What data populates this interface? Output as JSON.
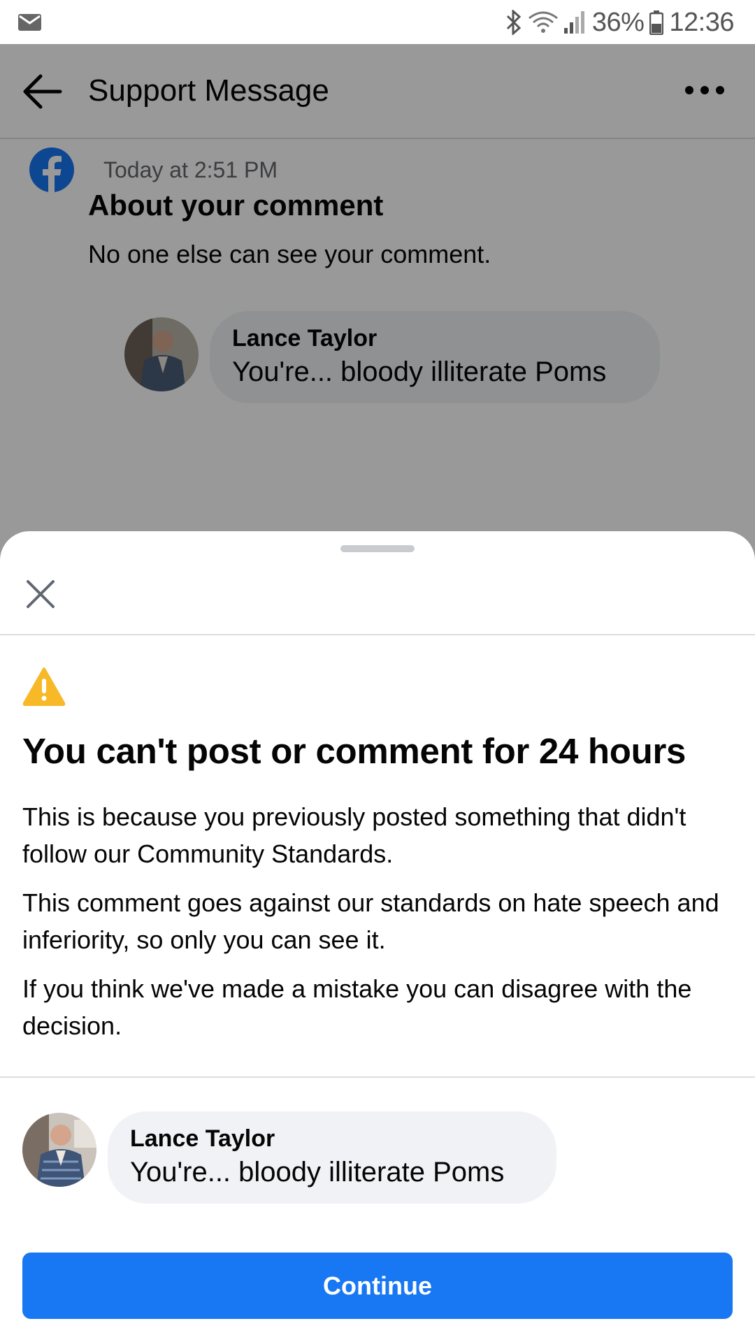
{
  "status_bar": {
    "battery": "36%",
    "time": "12:36"
  },
  "header": {
    "title": "Support Message"
  },
  "message": {
    "time": "Today at 2:51 PM",
    "heading": "About your comment",
    "body": "No one else can see your comment."
  },
  "comment": {
    "author": "Lance Taylor",
    "text": "You're...  bloody illiterate Poms"
  },
  "sheet": {
    "title": "You can't post or comment for 24 hours",
    "paragraphs": [
      "This is because you previously posted something that didn't follow our Community Standards.",
      "This comment goes against our standards on hate speech and inferiority, so only you can see it.",
      "If you think we've made a mistake you can disagree with the decision."
    ],
    "continue_label": "Continue"
  },
  "colors": {
    "accent": "#1877f2",
    "warning": "#f7b928",
    "bubble": "#f0f2f5",
    "secondary_text": "#65676b"
  },
  "icons": [
    "mail-icon",
    "bluetooth-icon",
    "wifi-icon",
    "signal-icon",
    "battery-icon",
    "back-arrow-icon",
    "more-icon",
    "facebook-logo-icon",
    "close-icon",
    "warning-icon"
  ]
}
